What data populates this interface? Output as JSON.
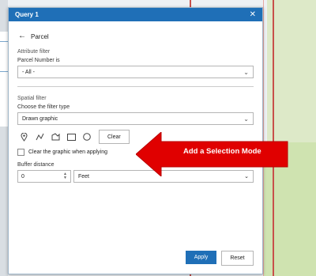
{
  "dialog": {
    "title": "Query 1",
    "close_icon": "close-icon",
    "back_label": "Parcel",
    "attribute_filter": {
      "section_label": "Attribute filter",
      "field_label": "Parcel Number is",
      "selected_value": "- All -"
    },
    "spatial_filter": {
      "section_label": "Spatial filter",
      "field_label": "Choose the filter type",
      "selected_value": "Drawn graphic",
      "tools": [
        "point-icon",
        "polyline-icon",
        "polygon-icon",
        "rectangle-icon",
        "circle-icon"
      ],
      "clear_label": "Clear",
      "checkbox_label": "Clear the graphic when applying",
      "checkbox_checked": false
    },
    "buffer": {
      "label": "Buffer distance",
      "value": "0",
      "unit": "Feet"
    },
    "footer": {
      "apply_label": "Apply",
      "reset_label": "Reset"
    }
  },
  "annotation": {
    "text": "Add a Selection Mode",
    "color": "#e00000"
  }
}
